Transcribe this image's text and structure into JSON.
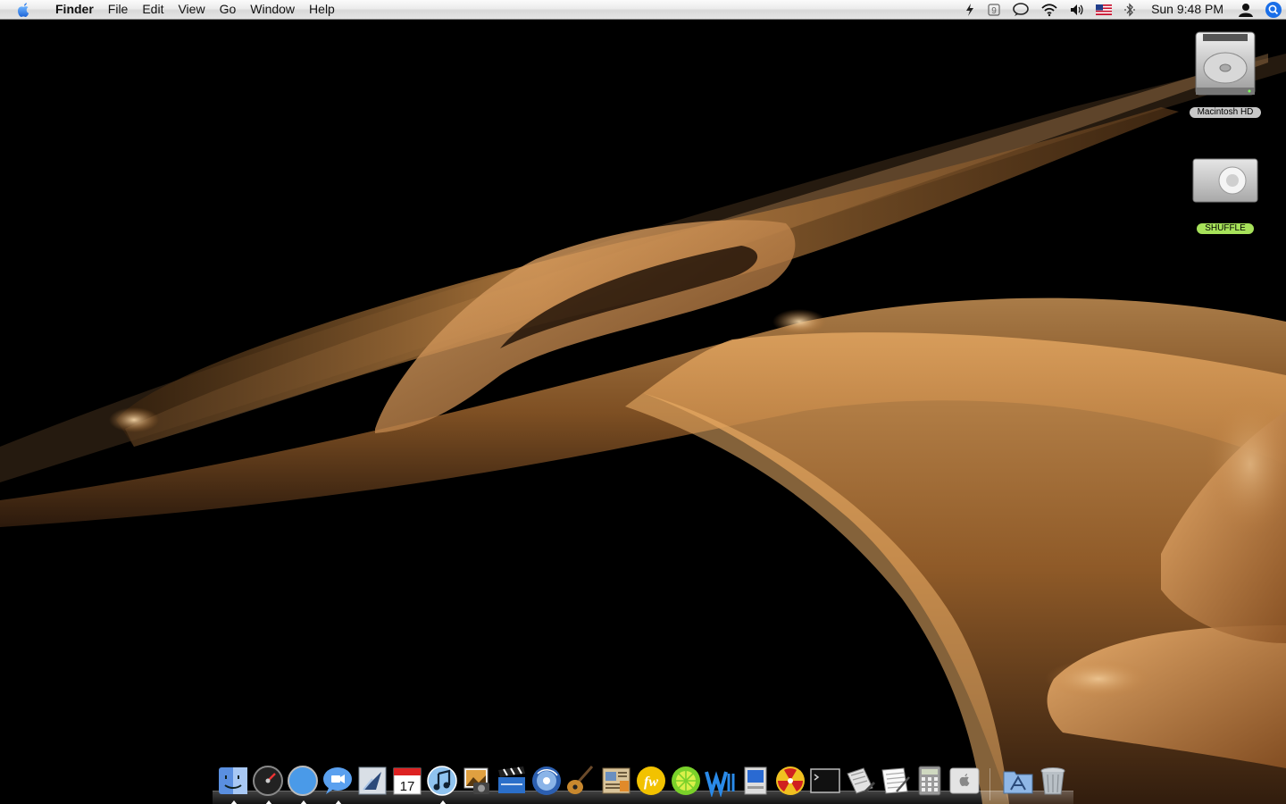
{
  "menubar": {
    "app_name": "Finder",
    "menus": [
      "File",
      "Edit",
      "View",
      "Go",
      "Window",
      "Help"
    ],
    "clock": "Sun 9:48 PM",
    "extras": [
      "script-icon",
      "spaces-icon",
      "ichat-status-icon",
      "airport-wifi-icon",
      "volume-icon",
      "us-flag-input-icon",
      "bluetooth-icon",
      "user-icon",
      "spotlight-icon"
    ]
  },
  "desktop": {
    "icons": [
      {
        "label": "Macintosh HD",
        "icon": "hard-drive-icon"
      },
      {
        "label": "SHUFFLE",
        "icon": "ipod-shuffle-icon"
      }
    ]
  },
  "dock": {
    "items": [
      {
        "icon": "finder-icon",
        "running": true
      },
      {
        "icon": "dashboard-icon",
        "running": true
      },
      {
        "icon": "safari-icon",
        "running": true
      },
      {
        "icon": "ichat-icon",
        "running": true
      },
      {
        "icon": "mail-icon",
        "running": false
      },
      {
        "icon": "ical-icon",
        "running": false,
        "text": "17"
      },
      {
        "icon": "itunes-icon",
        "running": true
      },
      {
        "icon": "iphoto-icon",
        "running": false
      },
      {
        "icon": "imovie-icon",
        "running": false
      },
      {
        "icon": "idvd-icon",
        "running": false
      },
      {
        "icon": "garageband-icon",
        "running": false
      },
      {
        "icon": "iweb-icon",
        "running": false
      },
      {
        "icon": "flash-app-icon",
        "running": false
      },
      {
        "icon": "limewire-icon",
        "running": false
      },
      {
        "icon": "word-app-icon",
        "running": false
      },
      {
        "icon": "system-profiler-icon",
        "running": false
      },
      {
        "icon": "burn-app-icon",
        "running": false
      },
      {
        "icon": "terminal-icon",
        "running": false
      },
      {
        "icon": "script-editor-icon",
        "running": false
      },
      {
        "icon": "textedit-icon",
        "running": false
      },
      {
        "icon": "calculator-icon",
        "running": false
      },
      {
        "icon": "apple-app-icon",
        "running": false
      },
      {
        "icon": "applications-folder-icon",
        "running": false
      },
      {
        "icon": "trash-icon",
        "running": false
      }
    ]
  },
  "colors": {
    "menubar": "#e8e8e8",
    "wallpaper_background": "#000000",
    "wallpaper_accent": "#c9853e",
    "shuffle_label": "#a7e25a",
    "hd_label": "#c8c8c8"
  }
}
